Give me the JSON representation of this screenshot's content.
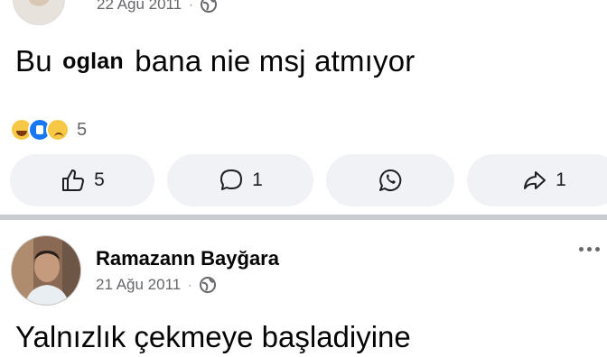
{
  "post1": {
    "date": "22 Ağu 2011",
    "separator": "·",
    "text_before": "Bu",
    "text_bold": "oglan",
    "text_after": "bana nie msj atmıyor",
    "reaction_icons": [
      "haha-reaction-icon",
      "like-reaction-icon",
      "sad-reaction-icon"
    ],
    "reaction_count": "5",
    "actions": {
      "like_count": "5",
      "comment_count": "1",
      "share_count": "1"
    }
  },
  "post2": {
    "author": "Ramazann Bayğara",
    "date": "21 Ağu 2011",
    "separator": "·",
    "text": "Yalnızlık çekmeye başladiyine"
  },
  "colors": {
    "pill_bg": "#f0f2f5",
    "divider": "#c9ccd1",
    "meta_text": "#65676b",
    "like_blue": "#1877f2"
  }
}
